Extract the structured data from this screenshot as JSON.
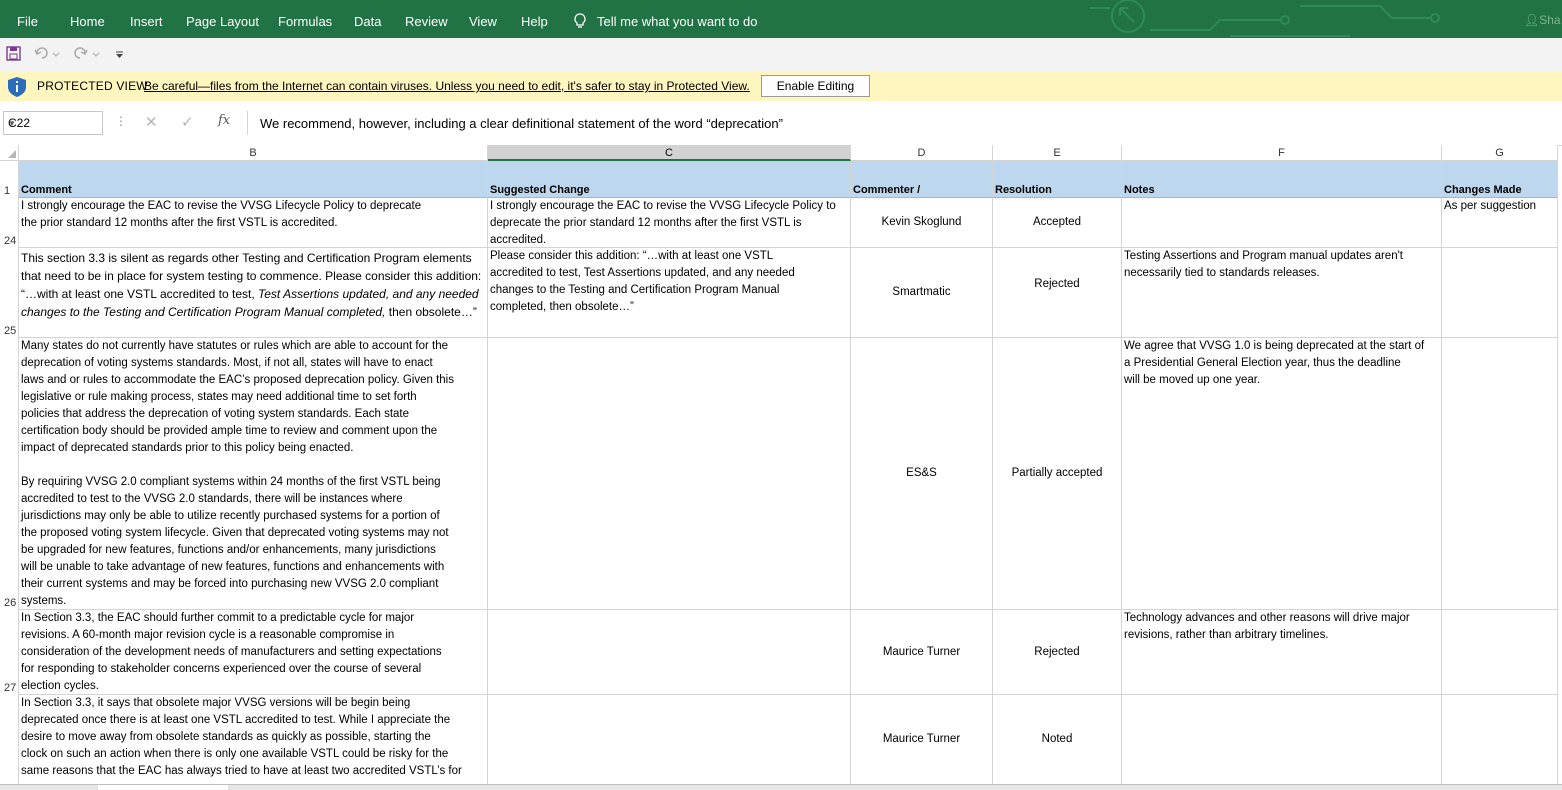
{
  "ribbon": {
    "tabs": [
      "File",
      "Home",
      "Insert",
      "Page Layout",
      "Formulas",
      "Data",
      "Review",
      "View",
      "Help"
    ],
    "tell_me": "Tell me what you want to do",
    "share": "Sha",
    "bg_color": "#217346"
  },
  "protected_view": {
    "label": "PROTECTED VIEW",
    "message": "Be careful—files from the Internet can contain viruses. Unless you need to edit, it's safer to stay in Protected View.",
    "button": "Enable Editing",
    "bg_color": "#fff5bf"
  },
  "formula_bar": {
    "name_box": "C22",
    "fx": "fx",
    "formula": "We recommend, however, including a clear definitional statement of the word “deprecation”"
  },
  "columns": [
    "B",
    "C",
    "D",
    "E",
    "F",
    "G"
  ],
  "selected_column": "C",
  "header_row": {
    "row_number": "1",
    "cells": [
      "Comment",
      "Suggested  Change",
      "Commenter / Organization",
      "Resolution",
      "Notes",
      "Changes Made"
    ],
    "color": "#bdd7ee"
  },
  "rows": [
    {
      "row_number": "24",
      "comment": "I strongly encourage the EAC to revise the VVSG Lifecycle Policy to deprecate\nthe prior standard 12 months after the first VSTL is accredited.",
      "suggested_change": "I strongly encourage the EAC to revise the VVSG Lifecycle Policy to\ndeprecate the prior standard 12 months after the first VSTL is\naccredited.",
      "commenter": "Kevin Skoglund",
      "resolution": "Accepted",
      "notes": "",
      "changes_made": "As per suggestion"
    },
    {
      "row_number": "25",
      "comment_plain": "This section 3.3 is silent as regards other Testing and Certification Program elements that need to be in place for system testing to commence.  Please consider this addition: “…with at least one VSTL accredited to test, ",
      "comment_italic": "Test Assertions updated, and any needed changes to the Testing and Certification Program Manual completed,",
      "comment_tail": "  then obsolete…”",
      "suggested_change": " Please consider this addition: “…with at least one VSTL\naccredited to test, Test Assertions updated, and any needed\nchanges to the Testing and Certification Program Manual\ncompleted, then obsolete…”",
      "commenter": "Smartmatic",
      "resolution": "Rejected",
      "notes": "Testing Assertions and Program manual updates aren't\nnecessarily tied to standards releases.",
      "changes_made": ""
    },
    {
      "row_number": "26",
      "comment": "Many states do not currently have statutes or rules which are able to account for the\ndeprecation of voting systems standards. Most, if not all, states will have to enact\nlaws and or rules to accommodate the EAC’s proposed deprecation policy. Given this\nlegislative or rule making process, states may need additional time to set forth\npolicies that address the deprecation of voting system standards. Each state\ncertification body should be provided ample time to review and comment upon the\nimpact of deprecated standards prior to this policy being enacted.\n\nBy requiring VVSG 2.0 compliant systems within 24 months of the first VSTL being\naccredited to test to the VVSG 2.0 standards, there will be instances where\njurisdictions may only be able to utilize recently purchased systems for a portion of\nthe proposed voting system lifecycle. Given that deprecated voting systems may not\nbe upgraded for new features, functions and/or enhancements, many jurisdictions\nwill be unable to take advantage of new features, functions and enhancements with\ntheir current systems and may be forced into purchasing new VVSG 2.0 compliant\nsystems.",
      "suggested_change": "",
      "commenter": "ES&S",
      "resolution": "Partially accepted",
      "notes": "We agree that VVSG 1.0 is being deprecated at the start of\na Presidential General Election year, thus the deadline\nwill be moved up one year.",
      "changes_made": ""
    },
    {
      "row_number": "27",
      "comment": "In Section 3.3, the EAC should further commit to a predictable cycle for major\nrevisions. A 60-month major revision cycle is a reasonable compromise in\nconsideration of the development needs of manufacturers and setting expectations\nfor responding to stakeholder concerns experienced over the course of several\nelection cycles.",
      "suggested_change": "",
      "commenter": "Maurice Turner",
      "resolution": "Rejected",
      "notes": "Technology advances and other reasons will drive major\nrevisions, rather than arbitrary timelines.",
      "changes_made": ""
    },
    {
      "row_number": "",
      "comment": "In Section 3.3, it says that obsolete major VVSG versions will be begin being\ndeprecated once there is at least one VSTL accredited to test. While I appreciate the\ndesire to move away from obsolete standards as quickly as possible, starting the\nclock on such an action when there is only one available VSTL could be risky for the\nsame reasons that the EAC has always tried to have at least two accredited VSTL’s for",
      "suggested_change": "",
      "commenter": "Maurice Turner",
      "resolution": "Noted",
      "notes": "",
      "changes_made": ""
    }
  ]
}
